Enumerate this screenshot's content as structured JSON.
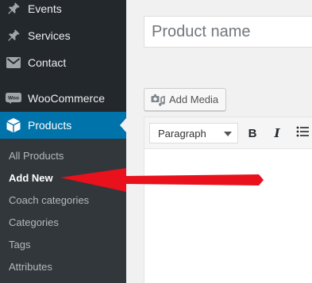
{
  "sidebar": {
    "items": [
      {
        "label": "Events",
        "icon": "pin-icon"
      },
      {
        "label": "Services",
        "icon": "pin-icon"
      },
      {
        "label": "Contact",
        "icon": "envelope-icon"
      },
      {
        "label": "WooCommerce",
        "icon": "woocommerce-icon"
      },
      {
        "label": "Products",
        "icon": "cube-icon",
        "active": true
      }
    ],
    "submenu": [
      {
        "label": "All Products"
      },
      {
        "label": "Add New",
        "current": true
      },
      {
        "label": "Coach categories"
      },
      {
        "label": "Categories"
      },
      {
        "label": "Tags"
      },
      {
        "label": "Attributes"
      }
    ]
  },
  "editor": {
    "title_placeholder": "Product name",
    "add_media_label": "Add Media",
    "format_select_value": "Paragraph",
    "bold_label": "B",
    "italic_label": "I"
  },
  "colors": {
    "sidebar_bg": "#23282d",
    "submenu_bg": "#32373c",
    "active_bg": "#0073aa",
    "annotation_arrow": "#e8111c"
  }
}
